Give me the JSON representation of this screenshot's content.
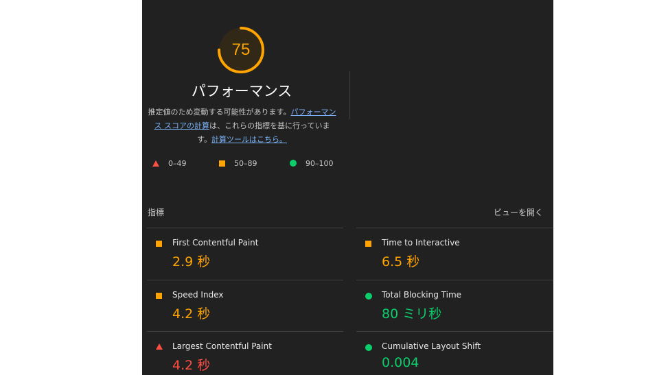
{
  "score": {
    "value": "75",
    "fraction": 0.75,
    "color": "#ffa400"
  },
  "title": "パフォーマンス",
  "description": {
    "text1": "推定値のため変動する可能性があります。",
    "link1": "パフォーマンス スコアの計算",
    "text2": "は、これらの指標を基に行っています。",
    "link2": "計算ツールはこちら。"
  },
  "legend": [
    {
      "label": "0–49",
      "icon": "triangle",
      "color": "#ff4e42"
    },
    {
      "label": "50–89",
      "icon": "square",
      "color": "#ffa400"
    },
    {
      "label": "90–100",
      "icon": "circle",
      "color": "#0cce6b"
    }
  ],
  "metrics_header": {
    "label": "指標",
    "expand": "ビューを開く"
  },
  "metrics": [
    {
      "name": "First Contentful Paint",
      "value": "2.9 秒",
      "rating": "average"
    },
    {
      "name": "Time to Interactive",
      "value": "6.5 秒",
      "rating": "average"
    },
    {
      "name": "Speed Index",
      "value": "4.2 秒",
      "rating": "average"
    },
    {
      "name": "Total Blocking Time",
      "value": "80 ミリ秒",
      "rating": "pass"
    },
    {
      "name": "Largest Contentful Paint",
      "value": "4.2 秒",
      "rating": "fail"
    },
    {
      "name": "Cumulative Layout Shift",
      "value": "0.004",
      "rating": "pass"
    }
  ]
}
